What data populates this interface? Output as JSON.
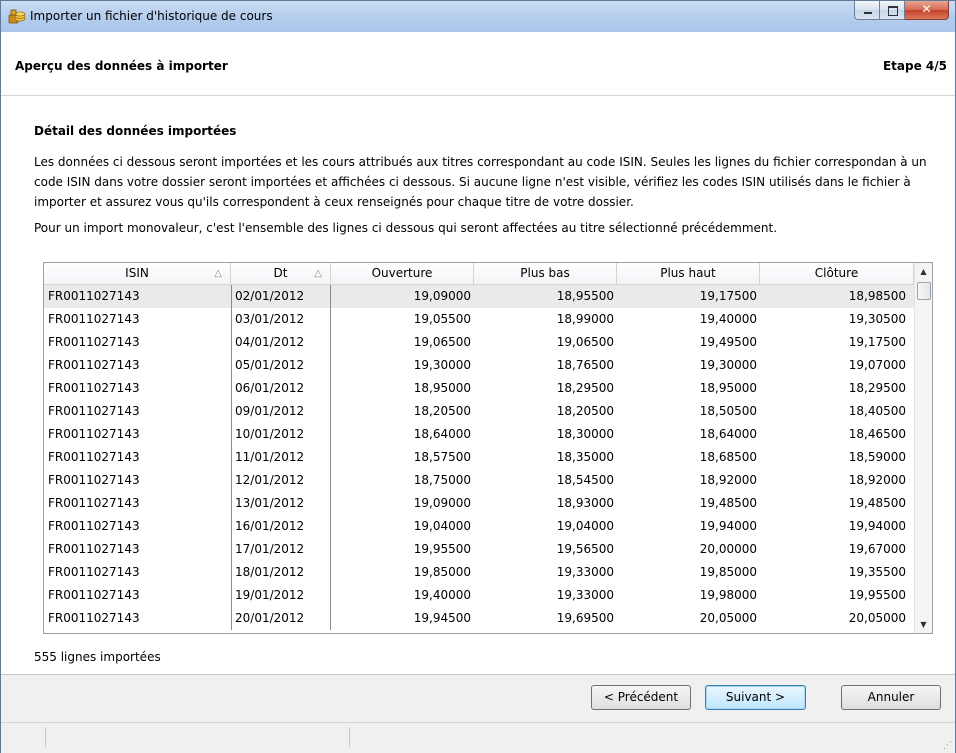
{
  "window": {
    "title": "Importer un fichier d'historique de cours",
    "icon": "coins-stack-icon"
  },
  "header": {
    "title": "Aperçu des données à importer",
    "step": "Etape 4/5"
  },
  "section": {
    "title": "Détail des données importées",
    "paragraph1": "Les données ci dessous seront importées et les cours attribués aux titres correspondant au code ISIN. Seules les lignes du fichier correspondan à un code ISIN dans votre dossier seront importées et affichées ci dessous. Si aucune ligne n'est visible, vérifiez les codes ISIN utilisés dans le fichier à importer et assurez vous qu'ils correspondent à ceux renseignés pour chaque titre de votre dossier.",
    "paragraph2": "Pour un import monovaleur, c'est l'ensemble des lignes ci dessous qui seront affectées au titre sélectionné précédemment."
  },
  "table": {
    "columns": [
      "ISIN",
      "Dt",
      "Ouverture",
      "Plus bas",
      "Plus haut",
      "Clôture"
    ],
    "sort_glyph": "△",
    "rows": [
      [
        "FR0011027143",
        "02/01/2012",
        "19,09000",
        "18,95500",
        "19,17500",
        "18,98500"
      ],
      [
        "FR0011027143",
        "03/01/2012",
        "19,05500",
        "18,99000",
        "19,40000",
        "19,30500"
      ],
      [
        "FR0011027143",
        "04/01/2012",
        "19,06500",
        "19,06500",
        "19,49500",
        "19,17500"
      ],
      [
        "FR0011027143",
        "05/01/2012",
        "19,30000",
        "18,76500",
        "19,30000",
        "19,07000"
      ],
      [
        "FR0011027143",
        "06/01/2012",
        "18,95000",
        "18,29500",
        "18,95000",
        "18,29500"
      ],
      [
        "FR0011027143",
        "09/01/2012",
        "18,20500",
        "18,20500",
        "18,50500",
        "18,40500"
      ],
      [
        "FR0011027143",
        "10/01/2012",
        "18,64000",
        "18,30000",
        "18,64000",
        "18,46500"
      ],
      [
        "FR0011027143",
        "11/01/2012",
        "18,57500",
        "18,35000",
        "18,68500",
        "18,59000"
      ],
      [
        "FR0011027143",
        "12/01/2012",
        "18,75000",
        "18,54500",
        "18,92000",
        "18,92000"
      ],
      [
        "FR0011027143",
        "13/01/2012",
        "19,09000",
        "18,93000",
        "19,48500",
        "19,48500"
      ],
      [
        "FR0011027143",
        "16/01/2012",
        "19,04000",
        "19,04000",
        "19,94000",
        "19,94000"
      ],
      [
        "FR0011027143",
        "17/01/2012",
        "19,95500",
        "19,56500",
        "20,00000",
        "19,67000"
      ],
      [
        "FR0011027143",
        "18/01/2012",
        "19,85000",
        "19,33000",
        "19,85000",
        "19,35500"
      ],
      [
        "FR0011027143",
        "19/01/2012",
        "19,40000",
        "19,33000",
        "19,98000",
        "19,95500"
      ],
      [
        "FR0011027143",
        "20/01/2012",
        "19,94500",
        "19,69500",
        "20,05000",
        "20,05000"
      ]
    ],
    "selected_row": 0
  },
  "count_label": "555 lignes importées",
  "buttons": {
    "previous": "< Précédent",
    "next": "Suivant >",
    "cancel": "Annuler"
  },
  "colors": {
    "titlebar": "#b9d1ee",
    "selected_row": "#eaeaea",
    "default_button_border": "#3c7fb1",
    "close_button": "#c4432b"
  }
}
